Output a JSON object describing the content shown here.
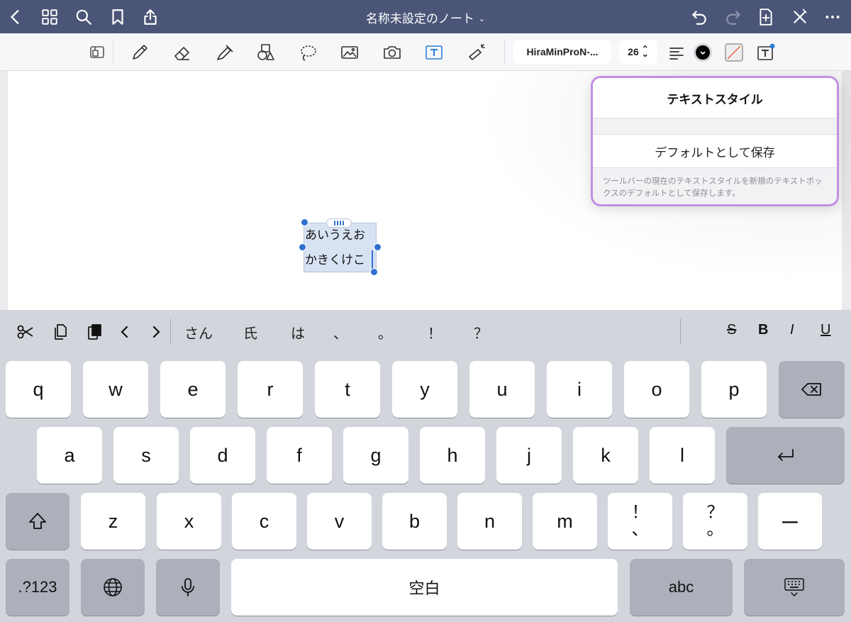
{
  "nav": {
    "title": "名称未設定のノート",
    "title_chevron": "⌄",
    "icons_left": [
      "back-chevron-icon",
      "grid-icon",
      "search-icon",
      "bookmark-icon",
      "share-icon"
    ],
    "icons_right": [
      "undo-icon",
      "redo-icon",
      "add-page-icon",
      "close-x-icon",
      "more-icon"
    ],
    "color": "#4a5577"
  },
  "toolbar": {
    "tools": [
      "page-layout-icon",
      "pen-icon",
      "eraser-icon",
      "highlighter-icon",
      "shapes-icon",
      "lasso-icon",
      "image-icon",
      "camera-icon",
      "text-tool-icon",
      "laser-pointer-icon"
    ],
    "font_name": "HiraMinProN-...",
    "font_size": "26",
    "size_stepper": "⌃⌄",
    "align_icon": "align-left-icon",
    "text_color": "#000000",
    "fill_color": "none",
    "text_style_icon": "text-style-icon"
  },
  "textbox": {
    "line1": "あいうえお",
    "line2": "かきくけこ"
  },
  "popover": {
    "title": "テキストスタイル",
    "save_default": "デフォルトとして保存",
    "note": "ツールバーの現在のテキストスタイルを新規のテキストボックスのデフォルトとして保存します。",
    "border_color": "#c38fe3"
  },
  "keyboard": {
    "suggestions": [
      "さん",
      "氏",
      "は",
      "、",
      "。",
      "！",
      "？"
    ],
    "format": {
      "strike": "S",
      "bold": "B",
      "italic": "I",
      "underline": "U"
    },
    "row1": [
      "q",
      "w",
      "e",
      "r",
      "t",
      "y",
      "u",
      "i",
      "o",
      "p"
    ],
    "row2": [
      "a",
      "s",
      "d",
      "f",
      "g",
      "h",
      "j",
      "k",
      "l"
    ],
    "row3": [
      "z",
      "x",
      "c",
      "v",
      "b",
      "n",
      "m"
    ],
    "punct1_top": "！",
    "punct1_bottom": "、",
    "punct2_top": "？",
    "punct2_bottom": "。",
    "dash": "ー",
    "numbers": ".?123",
    "space": "空白",
    "abc": "abc"
  }
}
